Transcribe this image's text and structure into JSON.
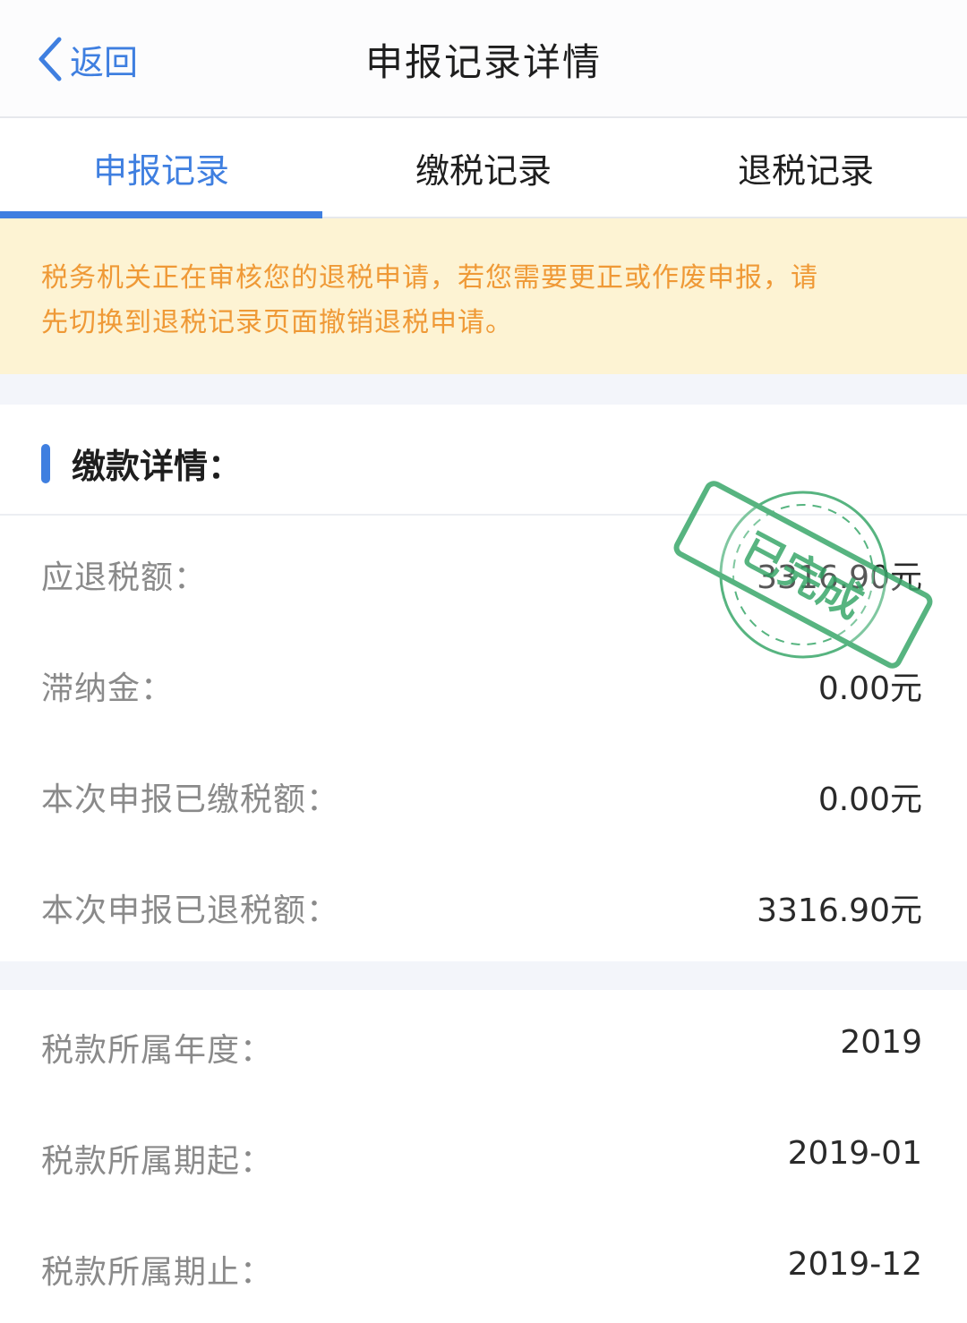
{
  "nav": {
    "back_label": "返回",
    "title": "申报记录详情"
  },
  "tabs": [
    {
      "label": "申报记录",
      "active": true
    },
    {
      "label": "缴税记录",
      "active": false
    },
    {
      "label": "退税记录",
      "active": false
    }
  ],
  "notice": {
    "line1": "税务机关正在审核您的退税申请，若您需要更正或作废申报，请",
    "line2": "先切换到退税记录页面撤销退税申请。"
  },
  "payment_section": {
    "title": "缴款详情：",
    "rows": [
      {
        "label": "应退税额：",
        "value": "3316.90元"
      },
      {
        "label": "滞纳金：",
        "value": "0.00元"
      },
      {
        "label": "本次申报已缴税额：",
        "value": "0.00元"
      },
      {
        "label": "本次申报已退税额：",
        "value": "3316.90元"
      }
    ]
  },
  "period_section": {
    "rows": [
      {
        "label": "税款所属年度：",
        "value": "2019"
      },
      {
        "label": "税款所属期起：",
        "value": "2019-01"
      },
      {
        "label": "税款所属期止：",
        "value": "2019-12"
      }
    ]
  },
  "stamp": {
    "text": "已完成",
    "color": "#3aa86b"
  },
  "colors": {
    "accent": "#3f7fe0",
    "notice_text": "#ef9936",
    "notice_bg": "#fdf3d3"
  },
  "icons": {
    "back": "chevron-left-icon"
  }
}
